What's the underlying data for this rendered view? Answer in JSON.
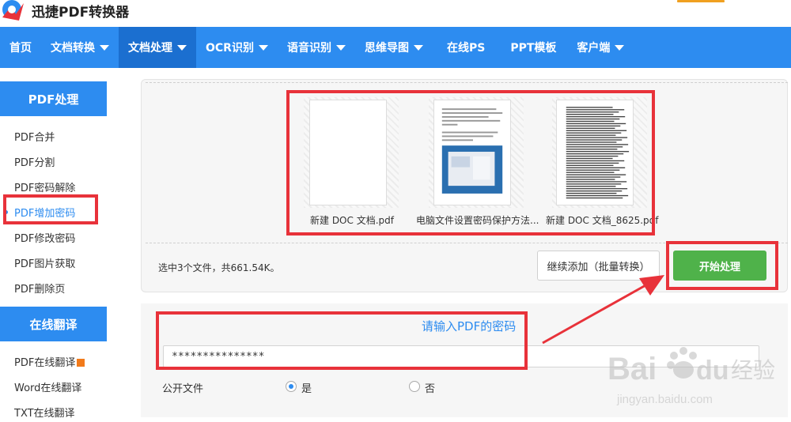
{
  "header": {
    "app_title": "迅捷PDF转换器"
  },
  "nav": {
    "items": [
      {
        "label": "首页",
        "dropdown": false
      },
      {
        "label": "文档转换",
        "dropdown": true
      },
      {
        "label": "文档处理",
        "dropdown": true,
        "active": true
      },
      {
        "label": "OCR识别",
        "dropdown": true
      },
      {
        "label": "语音识别",
        "dropdown": true
      },
      {
        "label": "思维导图",
        "dropdown": true
      },
      {
        "label": "在线PS",
        "dropdown": false
      },
      {
        "label": "PPT模板",
        "dropdown": false
      },
      {
        "label": "客户端",
        "dropdown": true
      }
    ]
  },
  "sidebar": {
    "section1_title": "PDF处理",
    "section1_items": [
      "PDF合并",
      "PDF分割",
      "PDF密码解除",
      "PDF增加密码",
      "PDF修改密码",
      "PDF图片获取",
      "PDF删除页"
    ],
    "active_index": 3,
    "section2_title": "在线翻译",
    "section2_items": [
      "PDF在线翻译",
      "Word在线翻译",
      "TXT在线翻译"
    ]
  },
  "files": [
    {
      "name": "新建 DOC 文档.pdf"
    },
    {
      "name": "电脑文件设置密码保护方法..."
    },
    {
      "name": "新建 DOC 文档_8625.pdf"
    }
  ],
  "status_text": "选中3个文件，共661.54K。",
  "buttons": {
    "continue_label": "继续添加（批量转换）",
    "start_label": "开始处理"
  },
  "password": {
    "prompt": "请输入PDF的密码",
    "value": "***************",
    "public_label": "公开文件",
    "yes_label": "是",
    "no_label": "否",
    "public_selected": "yes"
  },
  "watermark": {
    "brand": "Bai",
    "brand_cn": "经验",
    "url": "jingyan.baidu.com"
  },
  "colors": {
    "nav_blue": "#2d8cf0",
    "nav_active": "#1b6fd0",
    "start_green": "#4fb24a",
    "annotation_red": "#e8323a"
  }
}
